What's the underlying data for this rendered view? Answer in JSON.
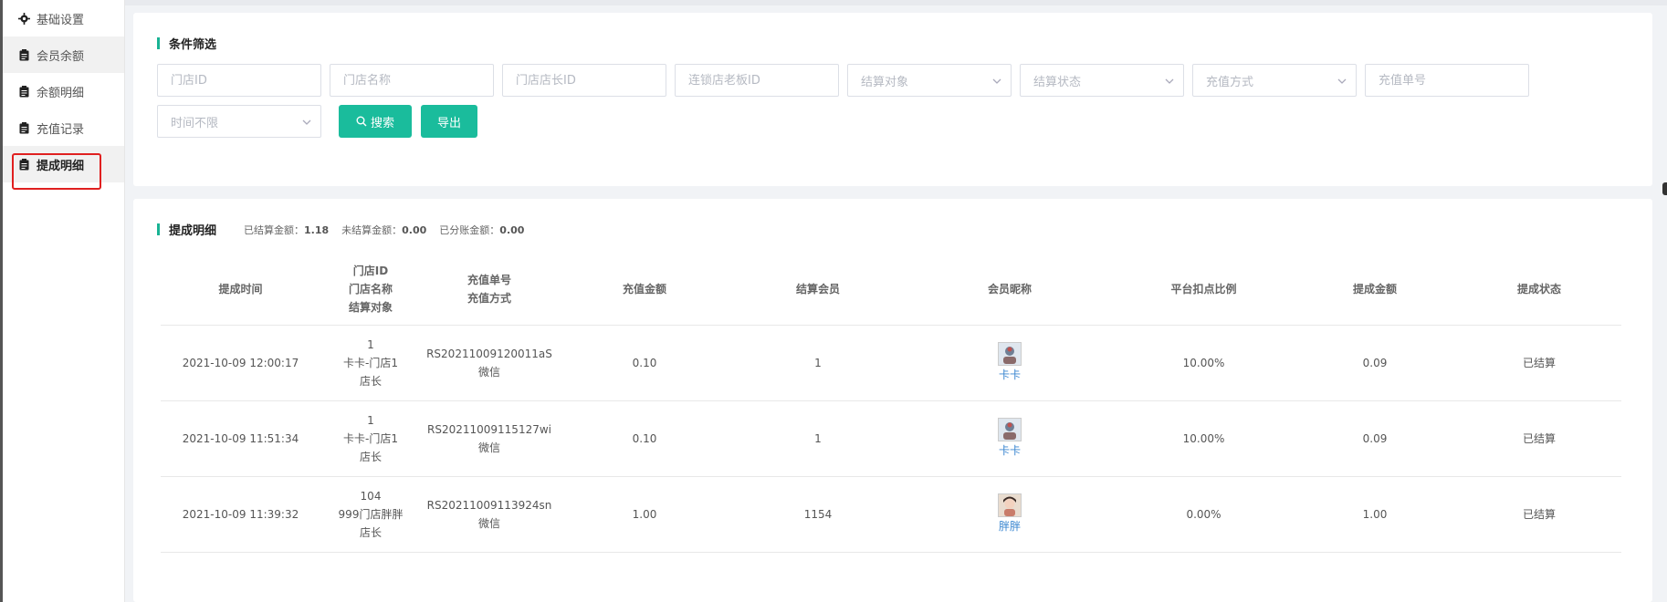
{
  "sidebar": {
    "items": [
      {
        "label": "基础设置",
        "icon": "gear-icon"
      },
      {
        "label": "会员余额",
        "icon": "clipboard-icon"
      },
      {
        "label": "余额明细",
        "icon": "clipboard-icon"
      },
      {
        "label": "充值记录",
        "icon": "clipboard-icon"
      },
      {
        "label": "提成明细",
        "icon": "clipboard-icon"
      }
    ],
    "active_index": 4
  },
  "filter": {
    "title": "条件筛选",
    "store_id_placeholder": "门店ID",
    "store_name_placeholder": "门店名称",
    "store_manager_id_placeholder": "门店店长ID",
    "chain_owner_id_placeholder": "连锁店老板ID",
    "settle_target_placeholder": "结算对象",
    "settle_status_placeholder": "结算状态",
    "recharge_method_placeholder": "充值方式",
    "recharge_no_placeholder": "充值单号",
    "time_placeholder": "时间不限",
    "search_label": "搜索",
    "export_label": "导出"
  },
  "list": {
    "title": "提成明细",
    "summary": {
      "settled_label": "已结算金额：",
      "settled_value": "1.18",
      "unsettled_label": "未结算金额：",
      "unsettled_value": "0.00",
      "split_label": "已分账金额：",
      "split_value": "0.00"
    },
    "columns": {
      "time": "提成时间",
      "store_id": "门店ID",
      "store_name": "门店名称",
      "settle_target": "结算对象",
      "recharge_no": "充值单号",
      "recharge_method": "充值方式",
      "amount": "充值金额",
      "settle_member": "结算会员",
      "nickname": "会员昵称",
      "ratio": "平台扣点比例",
      "commission": "提成金额",
      "status": "提成状态"
    },
    "rows": [
      {
        "time": "2021-10-09 12:00:17",
        "store_id": "1",
        "store_name": "卡卡-门店1",
        "settle_target": "店长",
        "recharge_no": "RS20211009120011aS",
        "recharge_method": "微信",
        "amount": "0.10",
        "settle_member": "1",
        "nickname": "卡卡",
        "ratio": "10.00%",
        "commission": "0.09",
        "status": "已结算"
      },
      {
        "time": "2021-10-09 11:51:34",
        "store_id": "1",
        "store_name": "卡卡-门店1",
        "settle_target": "店长",
        "recharge_no": "RS20211009115127wi",
        "recharge_method": "微信",
        "amount": "0.10",
        "settle_member": "1",
        "nickname": "卡卡",
        "ratio": "10.00%",
        "commission": "0.09",
        "status": "已结算"
      },
      {
        "time": "2021-10-09 11:39:32",
        "store_id": "104",
        "store_name": "999门店胖胖",
        "settle_target": "店长",
        "recharge_no": "RS20211009113924sn",
        "recharge_method": "微信",
        "amount": "1.00",
        "settle_member": "1154",
        "nickname": "胖胖",
        "ratio": "0.00%",
        "commission": "1.00",
        "status": "已结算"
      }
    ]
  },
  "colors": {
    "accent": "#1abc9c",
    "highlight_border": "#e02020",
    "link": "#3a86d0"
  }
}
